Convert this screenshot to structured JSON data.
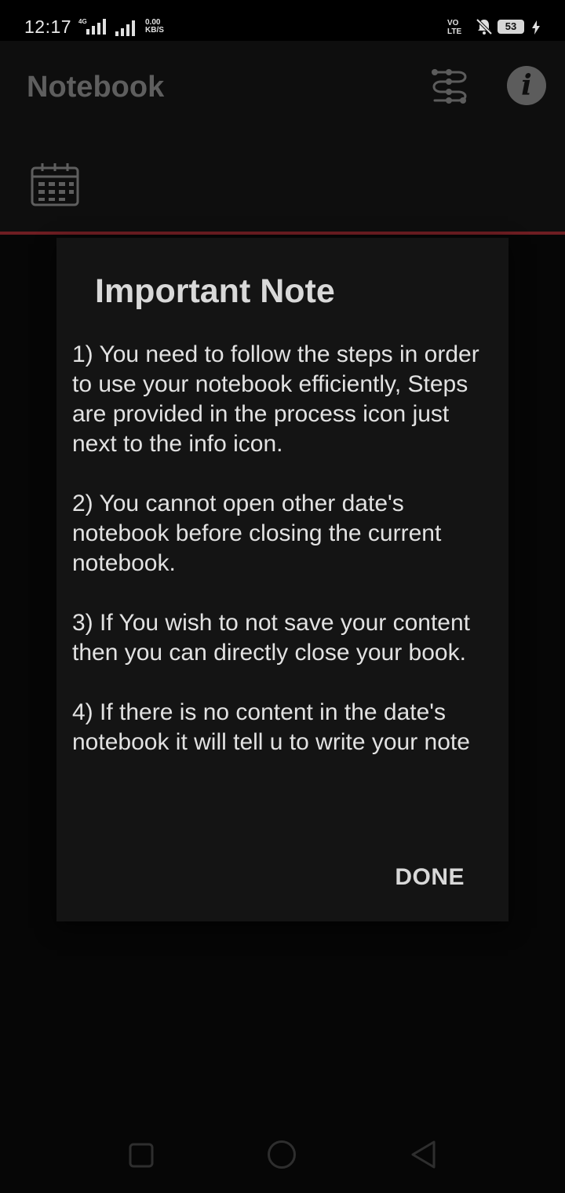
{
  "status_bar": {
    "time": "12:17",
    "network_type": "4G",
    "speed_value": "0.00",
    "speed_unit": "KB/S",
    "volte_line1": "VO",
    "volte_line2": "LTE",
    "battery_level": "53",
    "icons": [
      "signal-icon",
      "signal-icon",
      "bell-muted-icon",
      "battery-icon",
      "charging-bolt-icon"
    ]
  },
  "app_bar": {
    "title": "Notebook",
    "actions": [
      "process-icon",
      "info-icon"
    ],
    "info_glyph": "i"
  },
  "toolbar": {
    "icons": [
      "calendar-icon"
    ]
  },
  "colors": {
    "accent_line": "#6e1d22",
    "dialog_background": "#141414",
    "scrim_background": "#060606"
  },
  "dialog": {
    "title": "Important Note",
    "paragraphs": [
      "1) You need to follow the steps in order to use your notebook efficiently, Steps are provided in the process icon just next to the info icon.",
      "2) You cannot open other date's notebook before closing the current notebook.",
      "3) If You wish to not save your content then you can directly close your book.",
      "4) If there is no content in the date's notebook it will tell u to write your note"
    ],
    "done_label": "DONE"
  },
  "nav_bar": {
    "icons": [
      "recent-apps-icon",
      "home-icon",
      "back-icon"
    ]
  }
}
